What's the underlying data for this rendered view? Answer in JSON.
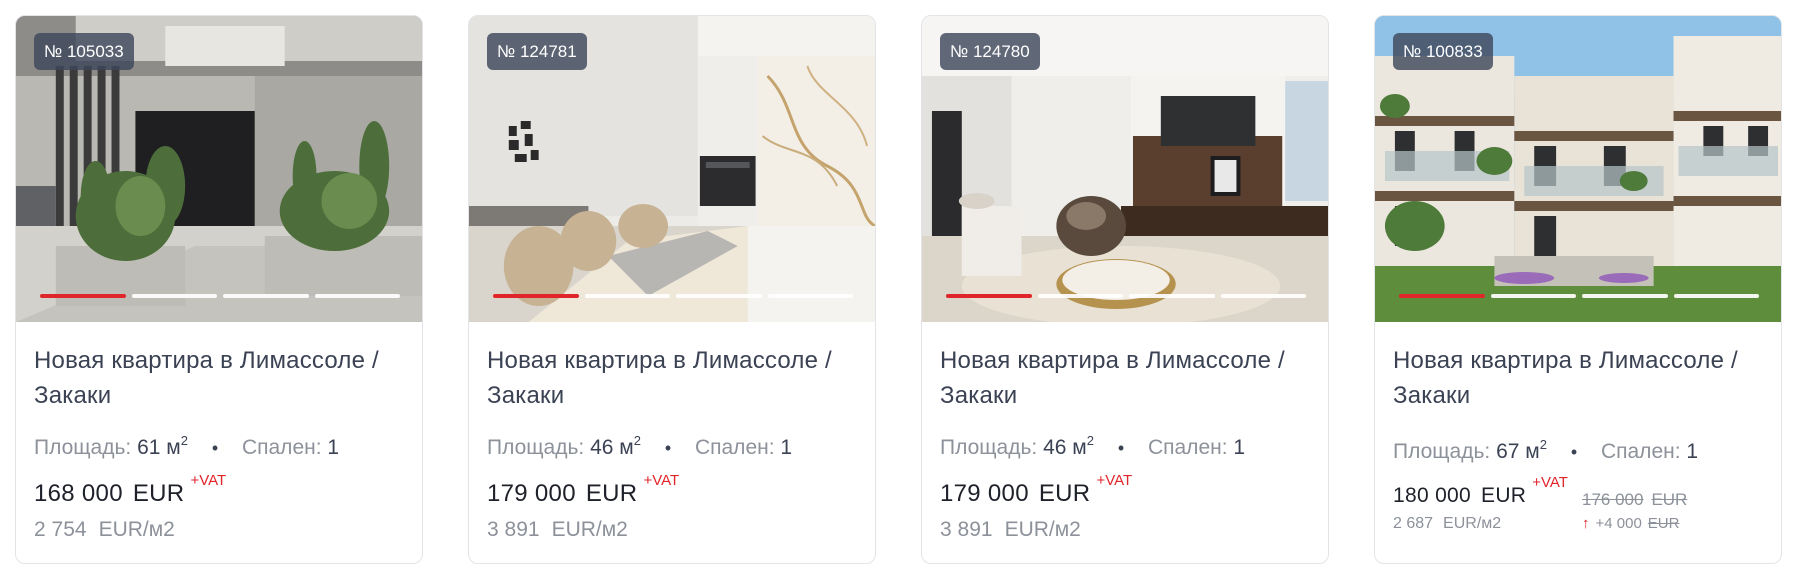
{
  "colors": {
    "accent": "#e0262b",
    "title": "#3b4254",
    "muted": "#8c919a",
    "badge_bg": "#3e485c"
  },
  "cards": [
    {
      "id": "№ 105033",
      "title": "Новая квартира в Лимассоле / Закаки",
      "area_label": "Площадь:",
      "area_value": "61 м",
      "area_sup": "2",
      "bedrooms_label": "Спален:",
      "bedrooms_value": "1",
      "price": "168 000",
      "currency": "EUR",
      "vat": "+VAT",
      "price_per_m2": "2 754",
      "per_m2_unit": "EUR/м2",
      "photo_icon": "building-entrance-photo",
      "slides_total": 4,
      "active_slide": 1
    },
    {
      "id": "№ 124781",
      "title": "Новая квартира в Лимассоле / Закаки",
      "area_label": "Площадь:",
      "area_value": "46 м",
      "area_sup": "2",
      "bedrooms_label": "Спален:",
      "bedrooms_value": "1",
      "price": "179 000",
      "currency": "EUR",
      "vat": "+VAT",
      "price_per_m2": "3 891",
      "per_m2_unit": "EUR/м2",
      "photo_icon": "kitchen-interior-photo",
      "slides_total": 4,
      "active_slide": 1
    },
    {
      "id": "№ 124780",
      "title": "Новая квартира в Лимассоле / Закаки",
      "area_label": "Площадь:",
      "area_value": "46 м",
      "area_sup": "2",
      "bedrooms_label": "Спален:",
      "bedrooms_value": "1",
      "price": "179 000",
      "currency": "EUR",
      "vat": "+VAT",
      "price_per_m2": "3 891",
      "per_m2_unit": "EUR/м2",
      "photo_icon": "living-room-photo",
      "slides_total": 4,
      "active_slide": 1
    },
    {
      "id": "№ 100833",
      "title": "Новая квартира в Лимассоле / Закаки",
      "area_label": "Площадь:",
      "area_value": "67 м",
      "area_sup": "2",
      "bedrooms_label": "Спален:",
      "bedrooms_value": "1",
      "price": "180 000",
      "currency": "EUR",
      "vat": "+VAT",
      "price_per_m2": "2 687",
      "per_m2_unit": "EUR/м2",
      "old_price": "176 000",
      "old_currency": "EUR",
      "price_delta": "+4 000",
      "delta_currency": "EUR",
      "photo_icon": "building-exterior-photo",
      "slides_total": 4,
      "active_slide": 1
    }
  ]
}
